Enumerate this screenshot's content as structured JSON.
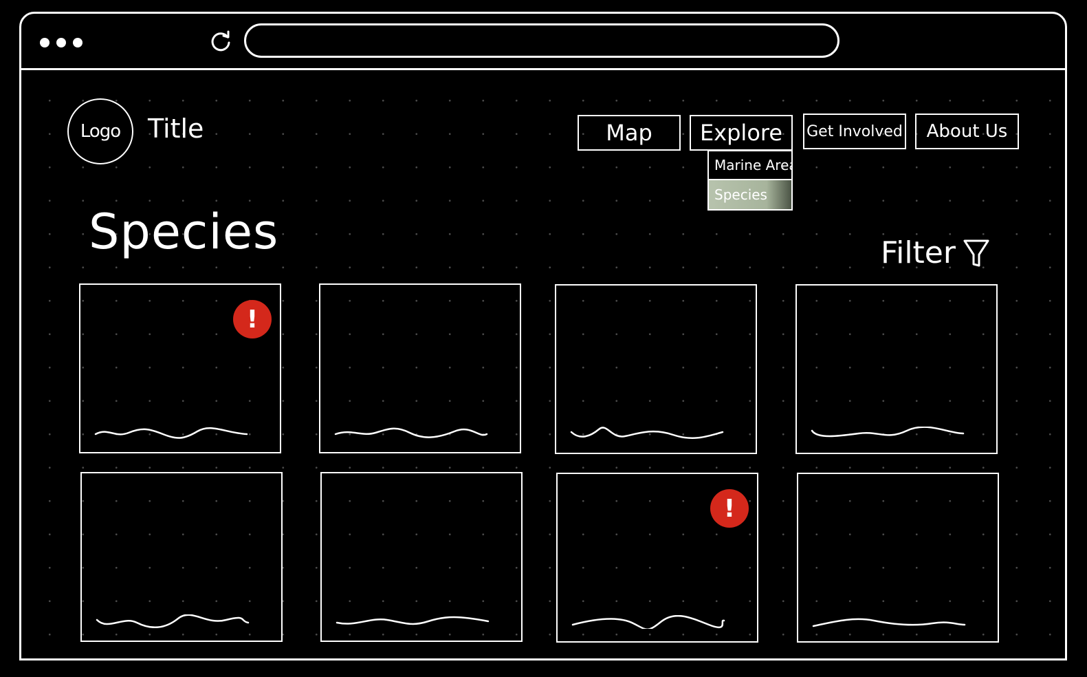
{
  "browser": {
    "url": ""
  },
  "header": {
    "logo_label": "Logo",
    "title": "Title"
  },
  "nav": {
    "items": [
      {
        "label": "Map"
      },
      {
        "label": "Explore"
      },
      {
        "label": "Get Involved"
      },
      {
        "label": "About Us"
      }
    ],
    "explore_dropdown": [
      {
        "label": "Marine Areas",
        "active": false
      },
      {
        "label": "Species",
        "active": true
      }
    ]
  },
  "main": {
    "heading": "Species",
    "filter_label": "Filter",
    "cards": [
      {
        "alert": true,
        "alert_symbol": "!"
      },
      {
        "alert": false
      },
      {
        "alert": false
      },
      {
        "alert": false
      },
      {
        "alert": false
      },
      {
        "alert": false
      },
      {
        "alert": true,
        "alert_symbol": "!"
      },
      {
        "alert": false
      }
    ]
  },
  "colors": {
    "background": "#000000",
    "foreground": "#ffffff",
    "alert": "#d4281b",
    "dropdown_active": "#a7b49c"
  },
  "icons": {
    "window_controls": "three-dots-icon",
    "reload": "reload-icon",
    "filter": "funnel-icon"
  }
}
